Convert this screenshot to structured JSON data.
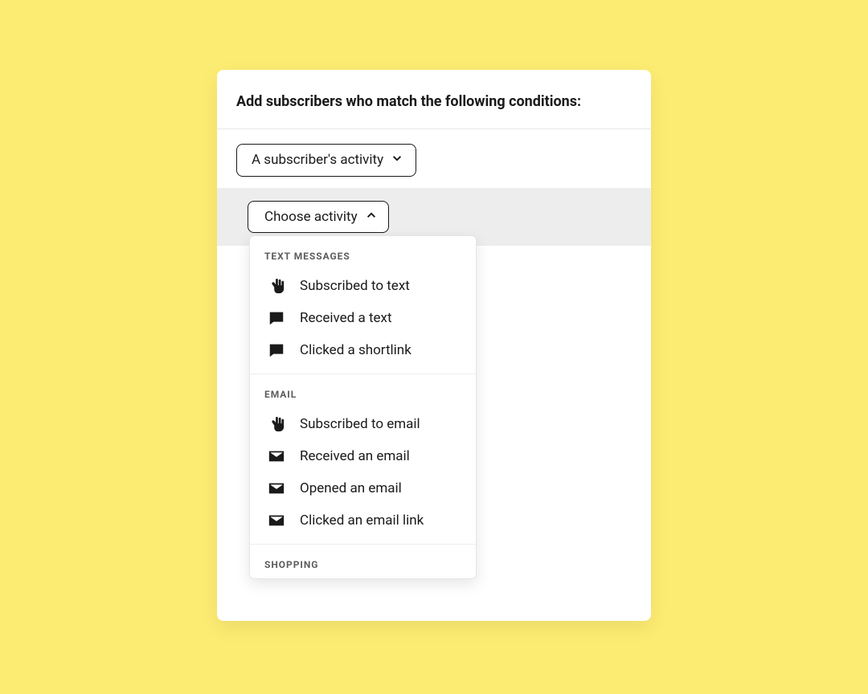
{
  "header": {
    "title": "Add subscribers who match the following conditions:"
  },
  "condition_selector": {
    "label": "A subscriber's activity"
  },
  "activity_selector": {
    "label": "Choose activity"
  },
  "dropdown": {
    "groups": [
      {
        "label": "TEXT MESSAGES",
        "options": [
          {
            "icon": "hand",
            "label": "Subscribed to text"
          },
          {
            "icon": "chat",
            "label": "Received a text"
          },
          {
            "icon": "chat",
            "label": "Clicked a shortlink"
          }
        ]
      },
      {
        "label": "EMAIL",
        "options": [
          {
            "icon": "hand",
            "label": "Subscribed to email"
          },
          {
            "icon": "mail",
            "label": "Received an email"
          },
          {
            "icon": "mail",
            "label": "Opened an email"
          },
          {
            "icon": "mail",
            "label": "Clicked an email link"
          }
        ]
      },
      {
        "label": "SHOPPING",
        "options": []
      }
    ]
  }
}
